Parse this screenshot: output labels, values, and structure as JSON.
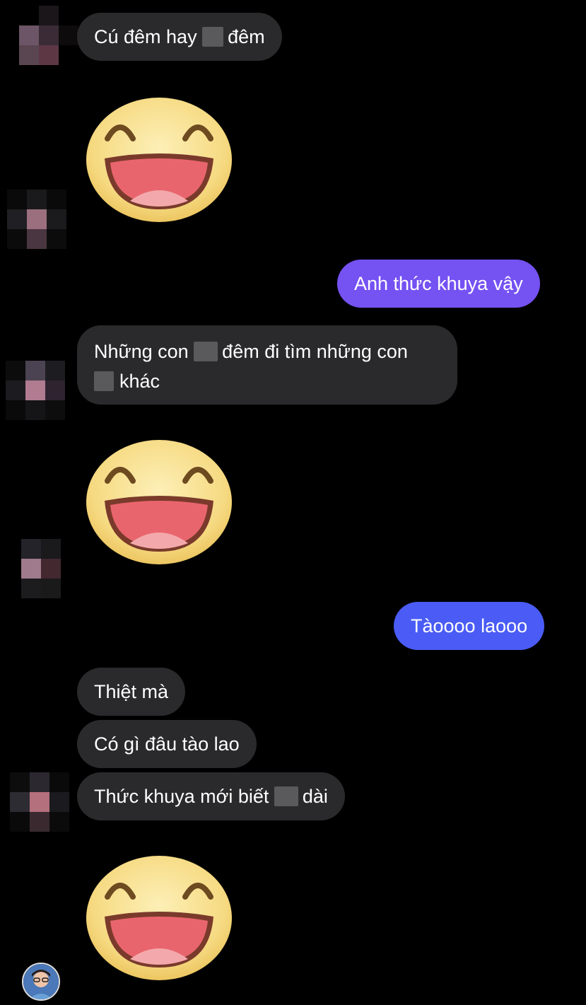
{
  "messages": [
    {
      "id": "m1",
      "side": "in",
      "parts": [
        "Cú đêm hay ",
        "",
        "đêm"
      ]
    },
    {
      "id": "m3",
      "side": "out",
      "text": "Anh thức khuya vậy",
      "color": "#7552f2"
    },
    {
      "id": "m4",
      "side": "in",
      "line1": [
        "Những con ",
        "đêm đi tìm những con"
      ],
      "line2": "khác"
    },
    {
      "id": "m6",
      "side": "out",
      "text": "Tàoooo laooo",
      "color": "#4a5cf5"
    },
    {
      "id": "m7",
      "side": "in",
      "text": "Thiệt mà"
    },
    {
      "id": "m8",
      "side": "in",
      "text": "Có gì đâu tào lao"
    },
    {
      "id": "m9",
      "side": "in",
      "parts": [
        "Thức khuya mới biết ",
        "dài"
      ]
    }
  ],
  "stickers": [
    {
      "id": "s1",
      "icon": "laughing-face-sticker"
    },
    {
      "id": "s2",
      "icon": "laughing-face-sticker"
    },
    {
      "id": "s3",
      "icon": "laughing-face-sticker"
    }
  ],
  "colors": {
    "background": "#000000",
    "incoming_bubble": "#2a2a2c",
    "outgoing_bubble_1": "#7552f2",
    "outgoing_bubble_2": "#4a5cf5",
    "sticker_face": "#f7dd85",
    "sticker_mouth": "#e9656d"
  }
}
